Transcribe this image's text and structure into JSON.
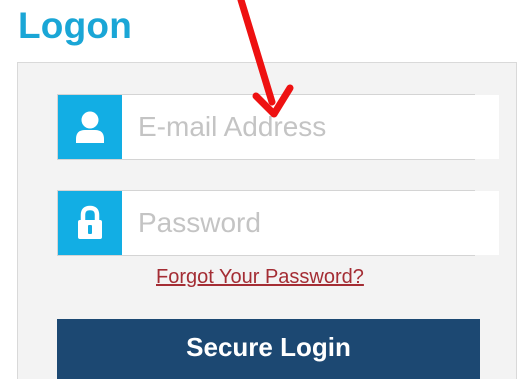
{
  "page": {
    "title": "Logon"
  },
  "form": {
    "email_placeholder": "E-mail Address",
    "email_value": "",
    "email_icon": "user-icon",
    "password_placeholder": "Password",
    "password_value": "",
    "password_icon": "lock-icon",
    "forgot_label": "Forgot Your Password?",
    "submit_label": "Secure Login"
  },
  "annotation": {
    "type": "arrow",
    "color": "#ee1111",
    "points_to": "email-field"
  },
  "colors": {
    "title": "#1aa6d6",
    "icon_bg": "#12aee4",
    "button_bg": "#1c4872",
    "link": "#a42d34",
    "panel_bg": "#f3f3f3"
  }
}
